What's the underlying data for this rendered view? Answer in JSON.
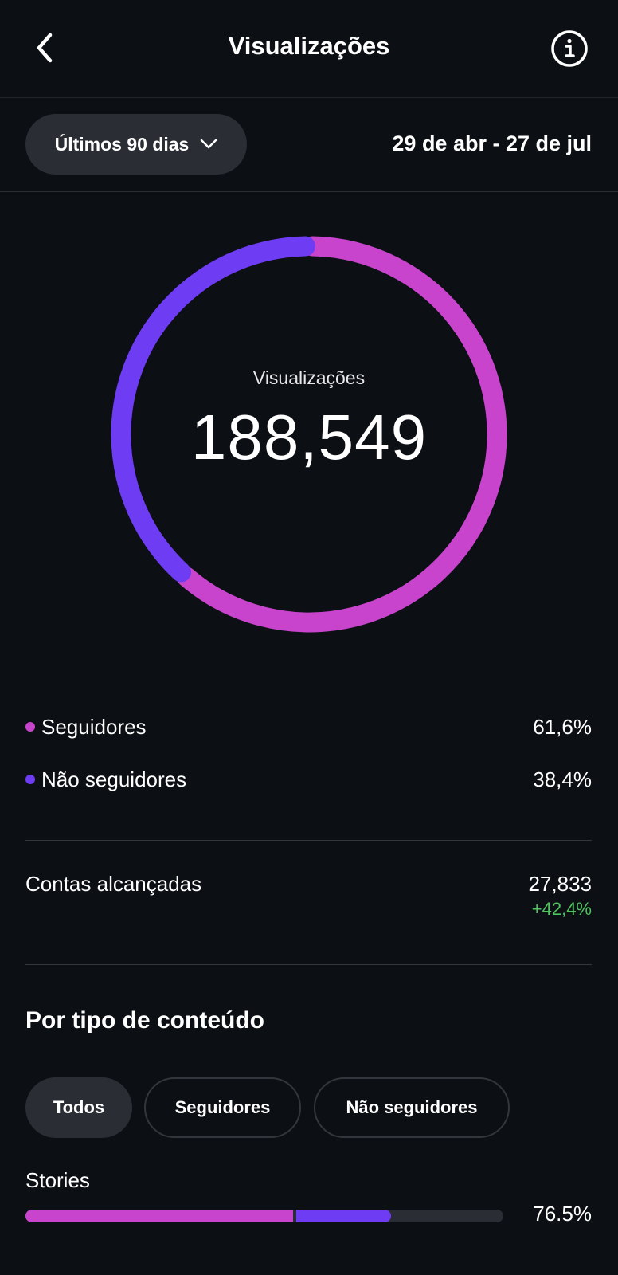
{
  "header": {
    "title": "Visualizações",
    "back_icon": "chevron-left-icon",
    "info_icon": "info-icon"
  },
  "filter": {
    "period_label": "Últimos 90 dias",
    "date_range": "29 de abr - 27 de jul"
  },
  "chart_data": {
    "type": "pie",
    "title": "Visualizações",
    "total": "188,549",
    "series": [
      {
        "name": "Seguidores",
        "value": 61.6,
        "color": "#c844cc"
      },
      {
        "name": "Não seguidores",
        "value": 38.4,
        "color": "#6e3cf2"
      }
    ]
  },
  "legend": [
    {
      "label": "Seguidores",
      "value": "61,6%",
      "color": "#c844cc"
    },
    {
      "label": "Não seguidores",
      "value": "38,4%",
      "color": "#6e3cf2"
    }
  ],
  "reach": {
    "label": "Contas alcançadas",
    "value": "27,833",
    "change": "+42,4%",
    "change_color": "#4fc561"
  },
  "content_type": {
    "title": "Por tipo de conteúdo",
    "chips": [
      {
        "label": "Todos",
        "active": true
      },
      {
        "label": "Seguidores",
        "active": false
      },
      {
        "label": "Não seguidores",
        "active": false
      }
    ],
    "stories": {
      "label": "Stories",
      "percent": "76.5%",
      "followers_fraction": 0.56,
      "non_followers_fraction": 0.205
    }
  }
}
